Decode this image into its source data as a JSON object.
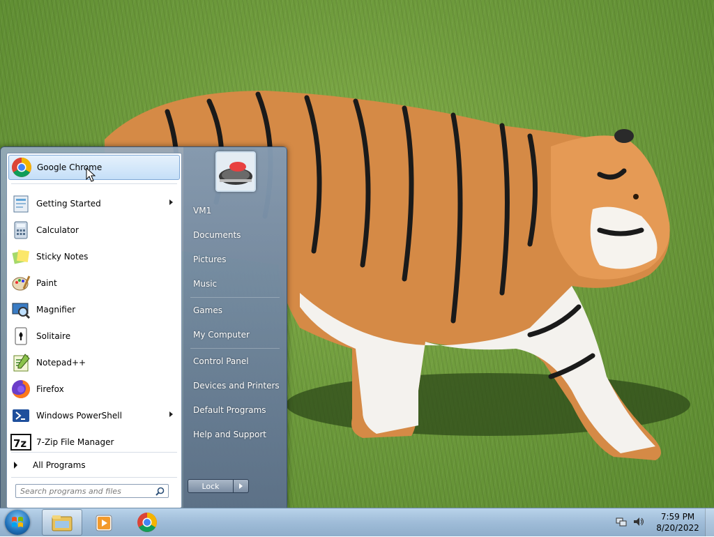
{
  "start_menu": {
    "programs": [
      {
        "label": "Google Chrome",
        "icon": "chrome-icon",
        "highlighted": true,
        "submenu": false
      },
      {
        "label": "Getting Started",
        "icon": "getting-started-icon",
        "submenu": true
      },
      {
        "label": "Calculator",
        "icon": "calculator-icon",
        "submenu": false
      },
      {
        "label": "Sticky Notes",
        "icon": "sticky-notes-icon",
        "submenu": false
      },
      {
        "label": "Paint",
        "icon": "paint-icon",
        "submenu": false
      },
      {
        "label": "Magnifier",
        "icon": "magnifier-icon",
        "submenu": false
      },
      {
        "label": "Solitaire",
        "icon": "solitaire-icon",
        "submenu": false
      },
      {
        "label": "Notepad++",
        "icon": "notepad-plus-plus-icon",
        "submenu": false
      },
      {
        "label": "Firefox",
        "icon": "firefox-icon",
        "submenu": false
      },
      {
        "label": "Windows PowerShell",
        "icon": "powershell-icon",
        "submenu": true
      },
      {
        "label": "7-Zip File Manager",
        "icon": "7zip-icon",
        "submenu": false
      }
    ],
    "all_programs": "All Programs",
    "search_placeholder": "Search programs and files",
    "right_items": [
      {
        "label": "VM1"
      },
      {
        "label": "Documents"
      },
      {
        "label": "Pictures"
      },
      {
        "label": "Music"
      },
      {
        "label": "Games"
      },
      {
        "label": "My Computer"
      },
      {
        "label": "Control Panel"
      },
      {
        "label": "Devices and Printers"
      },
      {
        "label": "Default Programs"
      },
      {
        "label": "Help and Support"
      }
    ],
    "lock_label": "Lock"
  },
  "taskbar": {
    "pinned": [
      "windows-explorer-icon",
      "media-player-icon",
      "chrome-icon"
    ],
    "time": "7:59 PM",
    "date": "8/20/2022"
  },
  "colors": {
    "accent": "#1e6fb8",
    "highlight_bg": "#c5dff8"
  }
}
